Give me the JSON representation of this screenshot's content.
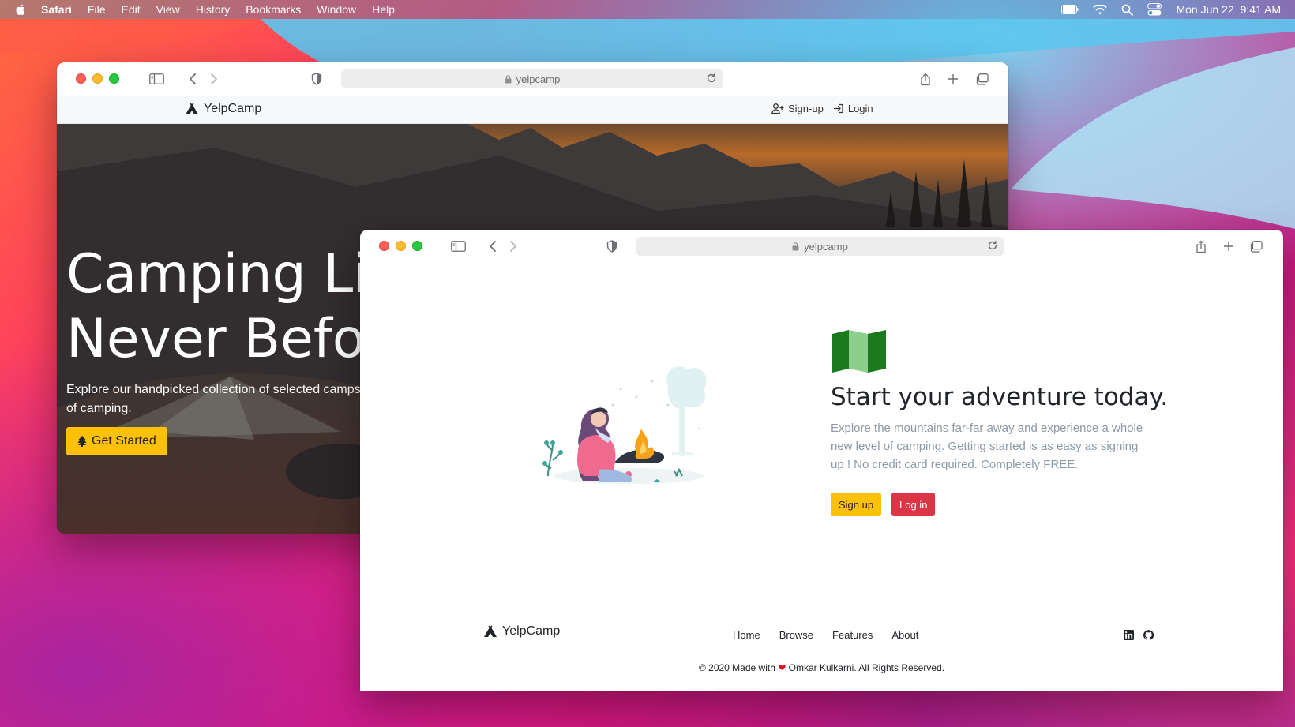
{
  "menubar": {
    "app_name": "Safari",
    "menus": [
      "File",
      "Edit",
      "View",
      "History",
      "Bookmarks",
      "Window",
      "Help"
    ],
    "date": "Mon Jun 22",
    "time": "9:41 AM"
  },
  "window_back": {
    "url": "yelpcamp",
    "nav": {
      "brand": "YelpCamp",
      "signup_label": "Sign-up",
      "login_label": "Login"
    },
    "hero": {
      "title_line1": "Camping Lik",
      "title_line2": "Never Befor",
      "subtitle": "Explore our handpicked collection of selected campsi way of camping.",
      "button_label": "Get Started"
    }
  },
  "window_front": {
    "url": "yelpcamp",
    "cta": {
      "title": "Start your adventure today.",
      "text": "Explore the mountains far-far away and experience a whole new level of camping. Getting started is as easy as signing up ! No credit card required. Completely FREE.",
      "signup_label": "Sign up",
      "login_label": "Log in"
    },
    "footer": {
      "brand": "YelpCamp",
      "links": [
        "Home",
        "Browse",
        "Features",
        "About"
      ],
      "copyright_prefix": "© 2020 Made with",
      "copyright_suffix": "Omkar Kulkarni. All Rights Reserved.",
      "social_icons": [
        "linkedin-icon",
        "github-icon"
      ]
    }
  },
  "colors": {
    "accent_yellow": "#ffc107",
    "accent_red": "#dc3545",
    "map_green": "#1b7a1e"
  }
}
